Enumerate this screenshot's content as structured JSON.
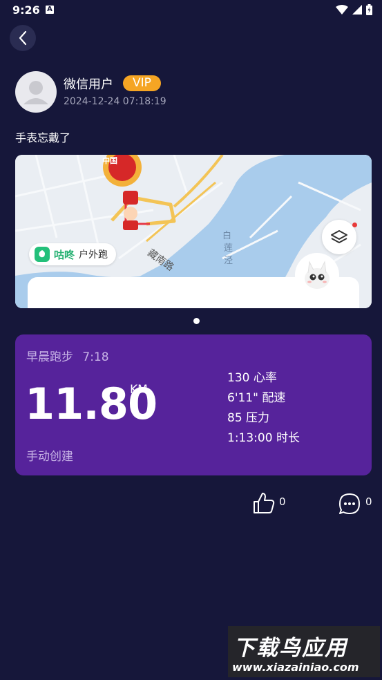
{
  "status_bar": {
    "time": "9:26",
    "notification_icon": "A"
  },
  "header": {
    "back_icon": "chevron-left-icon"
  },
  "post": {
    "username": "微信用户",
    "vip_label": "VIP",
    "datetime": "2024-12-24 07:18:19",
    "text": "手表忘戴了"
  },
  "map": {
    "app_name": "咕咚",
    "activity_type": "户外跑",
    "labels": [
      "白",
      "莲",
      "泾",
      "藏南路",
      "中国"
    ]
  },
  "run": {
    "title": "早晨跑步",
    "time": "7:18",
    "distance": "11.80",
    "unit": "KM",
    "note": "手动创建",
    "stats": [
      "130 心率",
      "6'11\" 配速",
      "85 压力",
      "1:13:00 时长"
    ]
  },
  "actions": {
    "like_count": "0",
    "comment_count": "0"
  },
  "watermark": {
    "main": "下载鸟应用",
    "url": "www.xiazainiao.com"
  },
  "colors": {
    "background": "#16173a",
    "card": "#56239b",
    "vip": "#f5a524",
    "app_green": "#23c07a"
  }
}
